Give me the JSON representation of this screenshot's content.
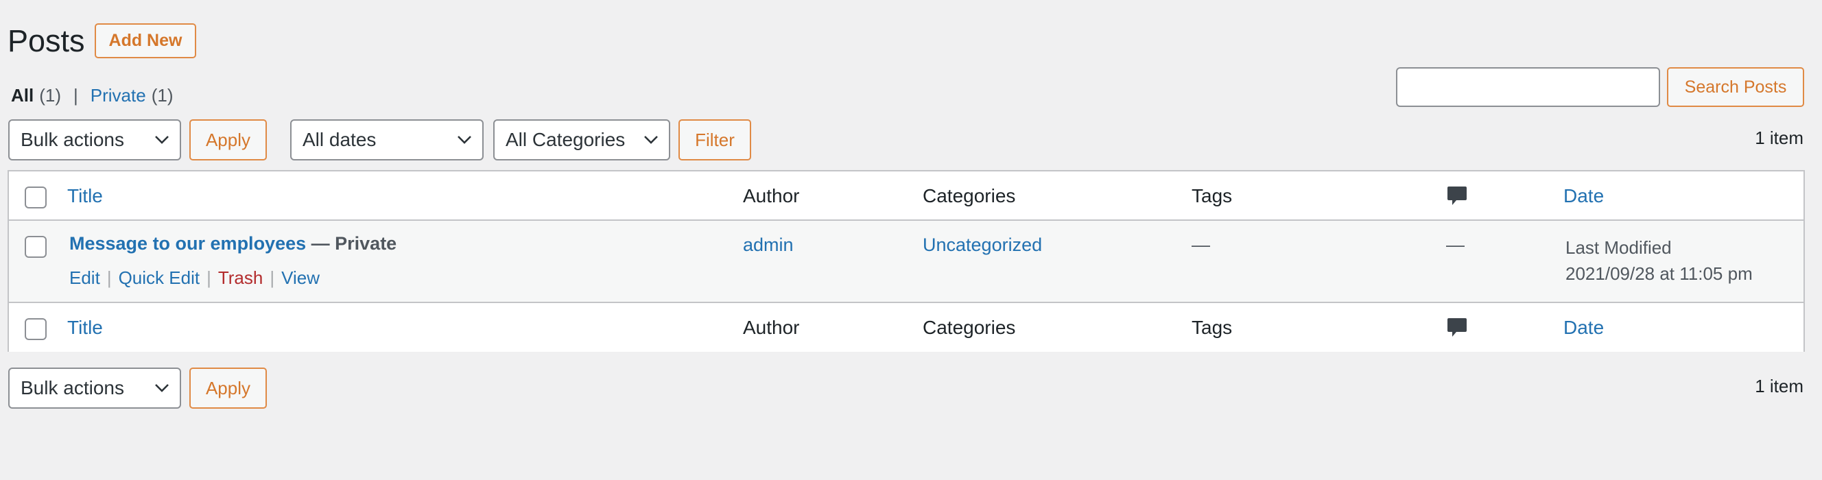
{
  "page": {
    "title": "Posts",
    "add_new_label": "Add New"
  },
  "views": [
    {
      "label": "All",
      "count": "(1)",
      "current": true
    },
    {
      "label": "Private",
      "count": "(1)",
      "current": false
    }
  ],
  "views_separator": "|",
  "search": {
    "value": "",
    "button_label": "Search Posts"
  },
  "filters": {
    "bulk_actions": "Bulk actions",
    "apply_label": "Apply",
    "dates": "All dates",
    "categories": "All Categories",
    "filter_label": "Filter"
  },
  "items_count": "1 item",
  "columns": {
    "title": "Title",
    "author": "Author",
    "categories": "Categories",
    "tags": "Tags",
    "comments_icon": "comment-icon",
    "date": "Date"
  },
  "rows": [
    {
      "title": "Message to our employees",
      "state": "— Private",
      "actions": {
        "edit": "Edit",
        "quick_edit": "Quick Edit",
        "trash": "Trash",
        "view": "View"
      },
      "author": "admin",
      "categories": "Uncategorized",
      "tags": "—",
      "comments": "—",
      "date_status": "Last Modified",
      "date_value": "2021/09/28 at 11:05 pm"
    }
  ],
  "action_separator": "|",
  "bottom": {
    "bulk_actions": "Bulk actions",
    "apply_label": "Apply",
    "items_count": "1 item"
  },
  "colors": {
    "background": "#f0f0f1",
    "link": "#2271b1",
    "accent_button": "#d5772b",
    "trash": "#b32d2e",
    "border": "#c3c4c7"
  }
}
